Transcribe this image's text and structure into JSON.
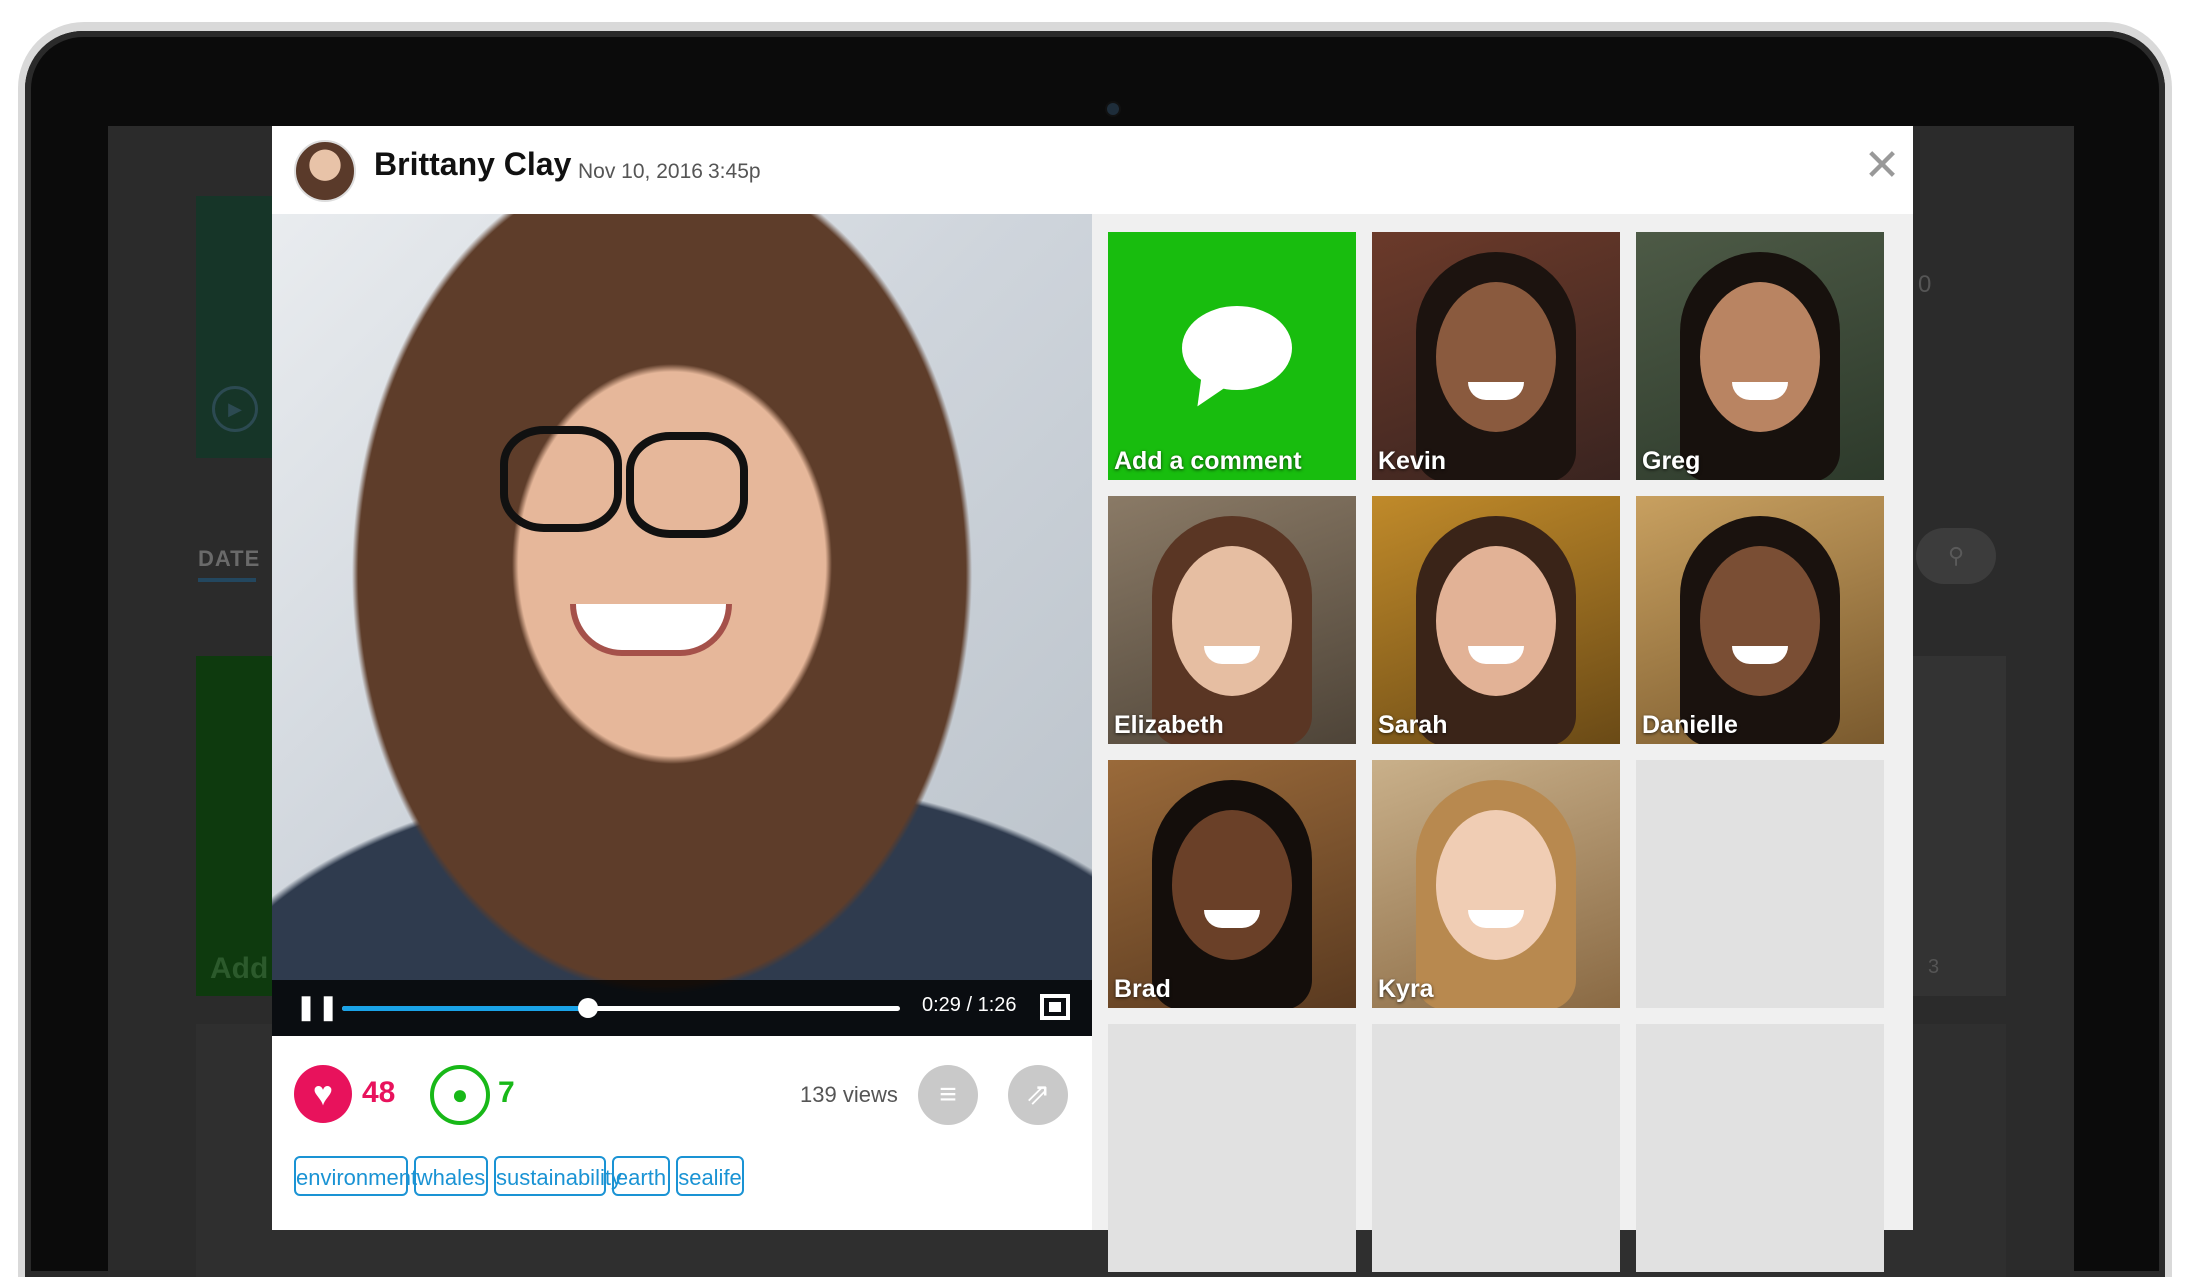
{
  "post": {
    "author": "Brittany Clay",
    "date": "Nov 10, 2016",
    "time": "3:45p",
    "close_icon": "close-icon"
  },
  "video": {
    "timecode": "0:29 / 1:26",
    "progress": 0.44,
    "pause_icon": "pause-icon",
    "fullscreen_icon": "fullscreen-icon"
  },
  "stats": {
    "likes": "48",
    "comments": "7",
    "views": "139 views"
  },
  "tags": [
    "environment",
    "whales",
    "sustainability",
    "earth",
    "sealife"
  ],
  "responses": {
    "add_comment_label": "Add a comment",
    "people": [
      "Kevin",
      "Greg",
      "Elizabeth",
      "Sarah",
      "Danielle",
      "Brad",
      "Kyra"
    ]
  },
  "colors": {
    "like": "#e8125c",
    "comment": "#18b818",
    "tag": "#1a93d4",
    "add_comment_tile": "#18bd0e",
    "seek_fill": "#1aa3e8"
  },
  "background": {
    "date_tab": "DATE",
    "add_text": "Add",
    "comment_count": "3",
    "partial_count": "0"
  }
}
